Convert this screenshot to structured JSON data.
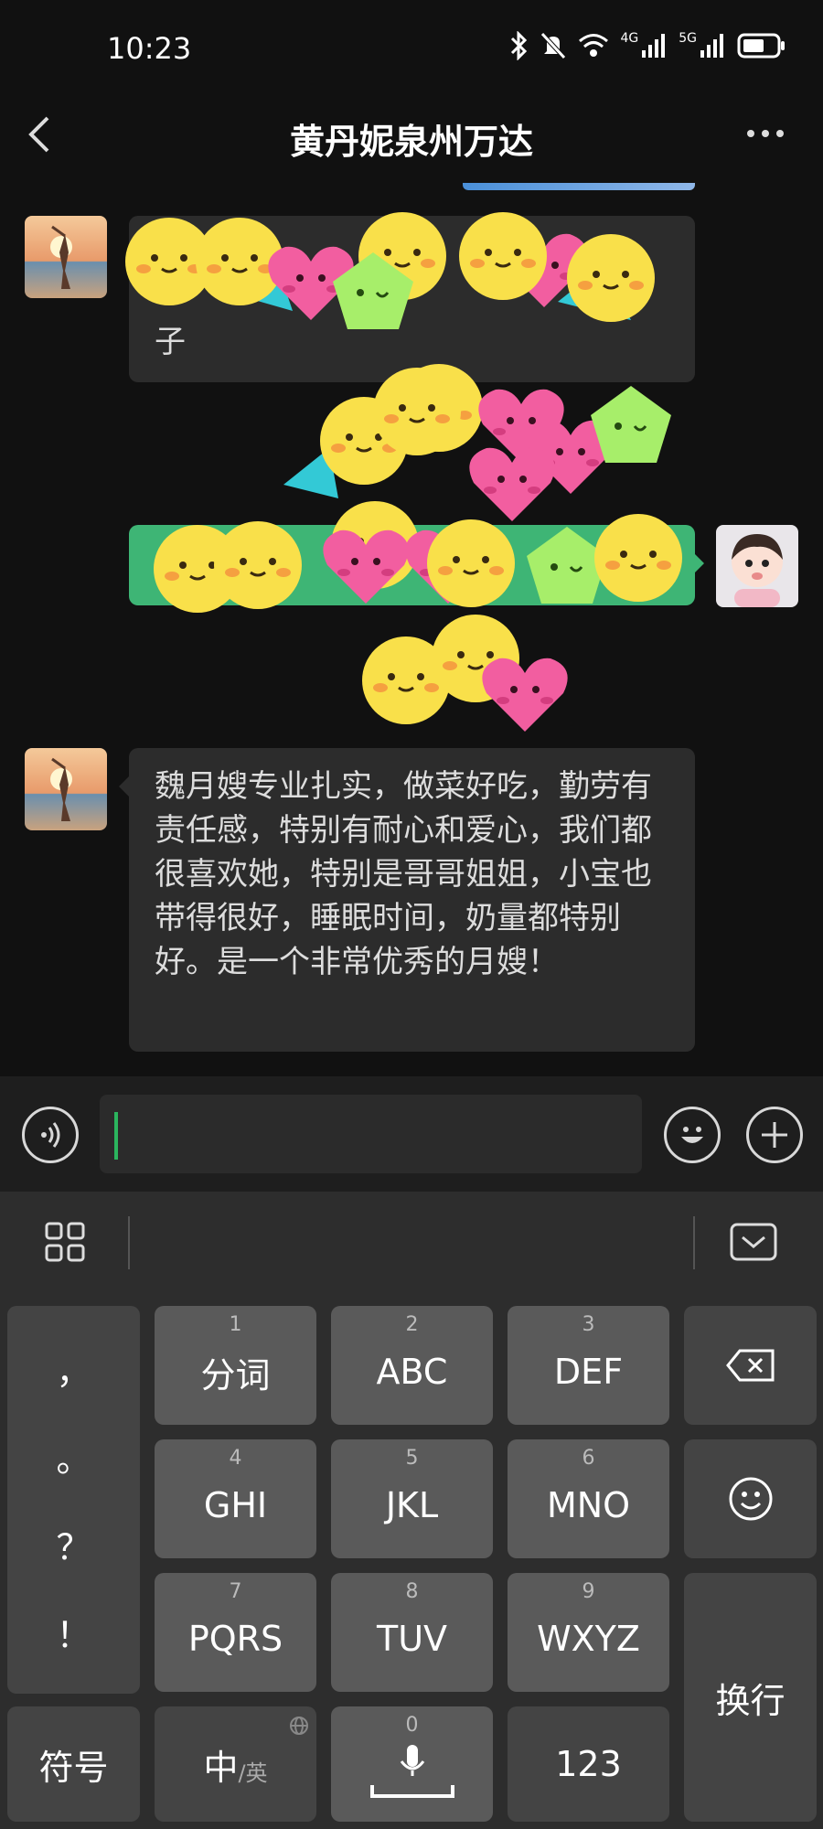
{
  "status_bar": {
    "time": "10:23",
    "net1": "4G",
    "net2": "5G",
    "icons": [
      "bluetooth-icon",
      "mute-icon",
      "wifi-icon",
      "signal-icon",
      "signal-icon",
      "battery-icon"
    ]
  },
  "nav": {
    "title": "黄丹妮泉州万达"
  },
  "messages": [
    {
      "side": "in",
      "text": "魏月嫂专业扎实，做菜好吃，勤劳有责任感，特别有耐心和爱心，我们都很喜欢她，特别是哥哥姐姐，小宝也带得很好，睡眠时间，奶量都特别好。是一个非常优秀的月嫂！"
    }
  ],
  "obscured_messages": {
    "first_in_tail": "子"
  },
  "input": {
    "value": ""
  },
  "keyboard": {
    "punct": [
      "，",
      "。",
      "？",
      "！"
    ],
    "keys": [
      {
        "num": "1",
        "label": "分词"
      },
      {
        "num": "2",
        "label": "ABC"
      },
      {
        "num": "3",
        "label": "DEF"
      },
      {
        "num": "4",
        "label": "GHI"
      },
      {
        "num": "5",
        "label": "JKL"
      },
      {
        "num": "6",
        "label": "MNO"
      },
      {
        "num": "7",
        "label": "PQRS"
      },
      {
        "num": "8",
        "label": "TUV"
      },
      {
        "num": "9",
        "label": "WXYZ"
      }
    ],
    "symbols": "符号",
    "lang_main": "中",
    "lang_sub": "/英",
    "space_num": "0",
    "numbers": "123",
    "enter": "换行"
  },
  "colors": {
    "accent": "#3eb575",
    "caret": "#2bb55e",
    "background": "#111111"
  }
}
